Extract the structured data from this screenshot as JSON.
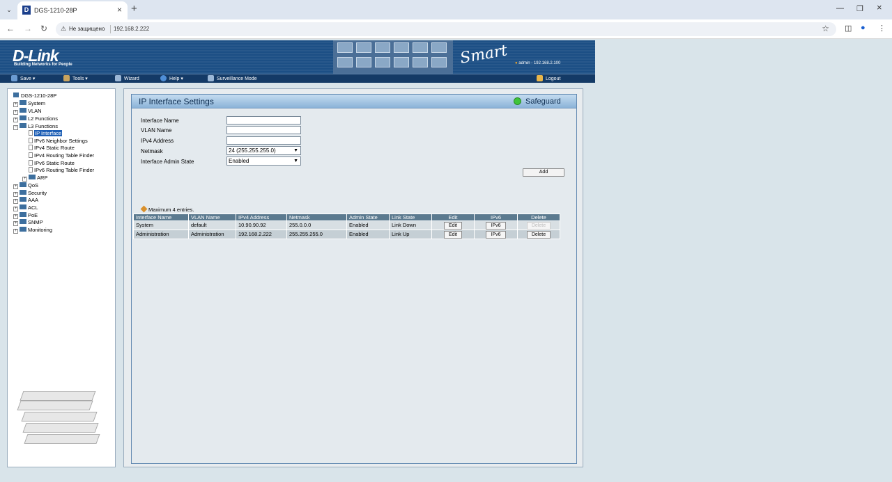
{
  "browser": {
    "tab_title": "DGS-1210-28P",
    "address_security": "Не защищено",
    "address_url": "192.168.2.222"
  },
  "header": {
    "logo": "D-Link",
    "tagline": "Building Networks for People",
    "brand_smart": "Smart",
    "user_info": "admin - 192.168.2.100"
  },
  "toolbar": {
    "save": "Save",
    "tools": "Tools",
    "wizard": "Wizard",
    "help": "Help",
    "surveillance": "Surveillance Mode",
    "logout": "Logout"
  },
  "tree": {
    "root": "DGS-1210-28P",
    "items": [
      "System",
      "VLAN",
      "L2 Functions",
      "L3 Functions"
    ],
    "l3_children": [
      "IP Interface",
      "IPv6 Neighbor Settings",
      "IPv4 Static Route",
      "IPv4 Routing Table Finder",
      "IPv6 Static Route",
      "IPv6 Routing Table Finder",
      "ARP"
    ],
    "rest": [
      "QoS",
      "Security",
      "AAA",
      "ACL",
      "PoE",
      "SNMP",
      "Monitoring"
    ]
  },
  "panel": {
    "title": "IP Interface Settings",
    "safeguard": "Safeguard",
    "form": {
      "interface_name_label": "Interface Name",
      "vlan_name_label": "VLAN Name",
      "ipv4_label": "IPv4 Address",
      "netmask_label": "Netmask",
      "admin_state_label": "Interface Admin State",
      "netmask_value": "24 (255.255.255.0)",
      "admin_state_value": "Enabled",
      "add_button": "Add"
    },
    "max_note": "Maximum 4 entries.",
    "table": {
      "headers": [
        "Interface Name",
        "VLAN Name",
        "IPv4 Address",
        "Netmask",
        "Admin State",
        "Link State",
        "Edit",
        "IPv6",
        "Delete"
      ],
      "rows": [
        {
          "name": "System",
          "vlan": "default",
          "ip": "10.90.90.92",
          "mask": "255.0.0.0",
          "admin": "Enabled",
          "link": "Link Down",
          "edit": "Edit",
          "ipv6": "IPv6",
          "delete": "Delete"
        },
        {
          "name": "Administration",
          "vlan": "Administration",
          "ip": "192.168.2.222",
          "mask": "255.255.255.0",
          "admin": "Enabled",
          "link": "Link Up",
          "edit": "Edit",
          "ipv6": "IPv6",
          "delete": "Delete"
        }
      ]
    }
  }
}
